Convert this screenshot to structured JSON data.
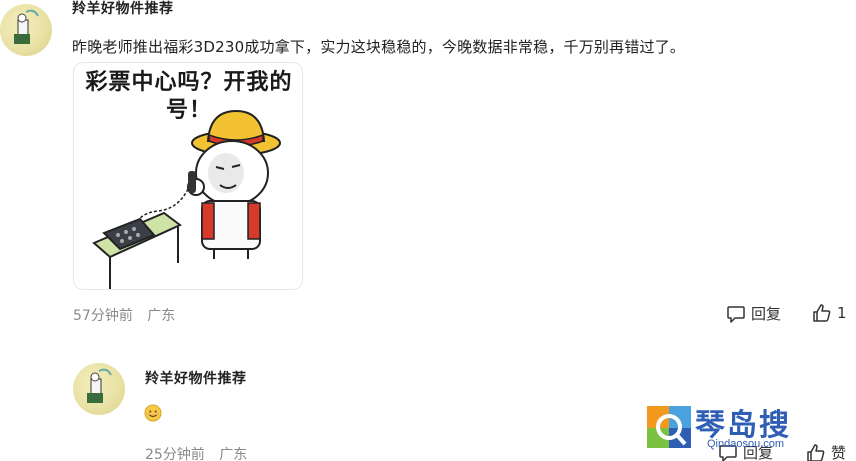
{
  "comments": [
    {
      "username": "羚羊好物件推荐",
      "text": "昨晚老师推出福彩3D230成功拿下，实力这块稳稳的，今晚数据非常稳，千万别再错过了。",
      "meme_caption_line1": "彩票中心吗？开我的",
      "meme_caption_line2": "号！",
      "time": "57分钟前",
      "location": "广东",
      "reply_label": "回复",
      "like_count": "1"
    },
    {
      "username": "羚羊好物件推荐",
      "emoji": "smiley-emoji",
      "time": "25分钟前",
      "location": "广东",
      "reply_label": "回复",
      "like_label": "赞"
    }
  ],
  "watermark": {
    "title": "琴岛搜",
    "url": "Qindaosou.com"
  },
  "colors": {
    "text": "#222222",
    "meta": "#8a8a8a",
    "watermark": "#2f5fb5"
  }
}
